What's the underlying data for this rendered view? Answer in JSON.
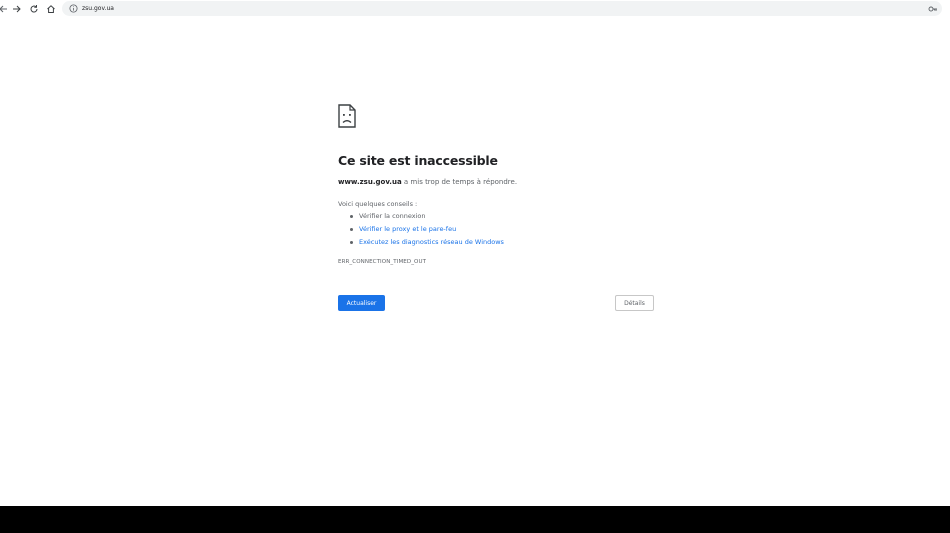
{
  "toolbar": {
    "back_icon": "arrow-back-icon",
    "forward_icon": "arrow-forward-icon",
    "reload_icon": "reload-icon",
    "home_icon": "home-icon",
    "site_info_icon": "site-info-icon",
    "url": "zsu.gov.ua",
    "password_icon": "key-icon"
  },
  "error_page": {
    "icon": "sad-page-icon",
    "title": "Ce site est inaccessible",
    "host": "www.zsu.gov.ua",
    "summary_rest": " a mis trop de temps à répondre.",
    "suggestions_heading": "Voici quelques conseils :",
    "suggestions": [
      {
        "label": "Vérifier la connexion",
        "link": false
      },
      {
        "label": "Vérifier le proxy et le pare-feu",
        "link": true
      },
      {
        "label": "Exécutez les diagnostics réseau de Windows",
        "link": true
      }
    ],
    "error_code": "ERR_CONNECTION_TIMED_OUT",
    "reload_label": "Actualiser",
    "details_label": "Détails"
  },
  "colors": {
    "primary_button": "#1a73e8",
    "link": "#1a73e8",
    "title_text": "#202124",
    "secondary_text": "#5f6368",
    "omnibox_bg": "#f1f3f4",
    "bottom_bar": "#000000"
  }
}
